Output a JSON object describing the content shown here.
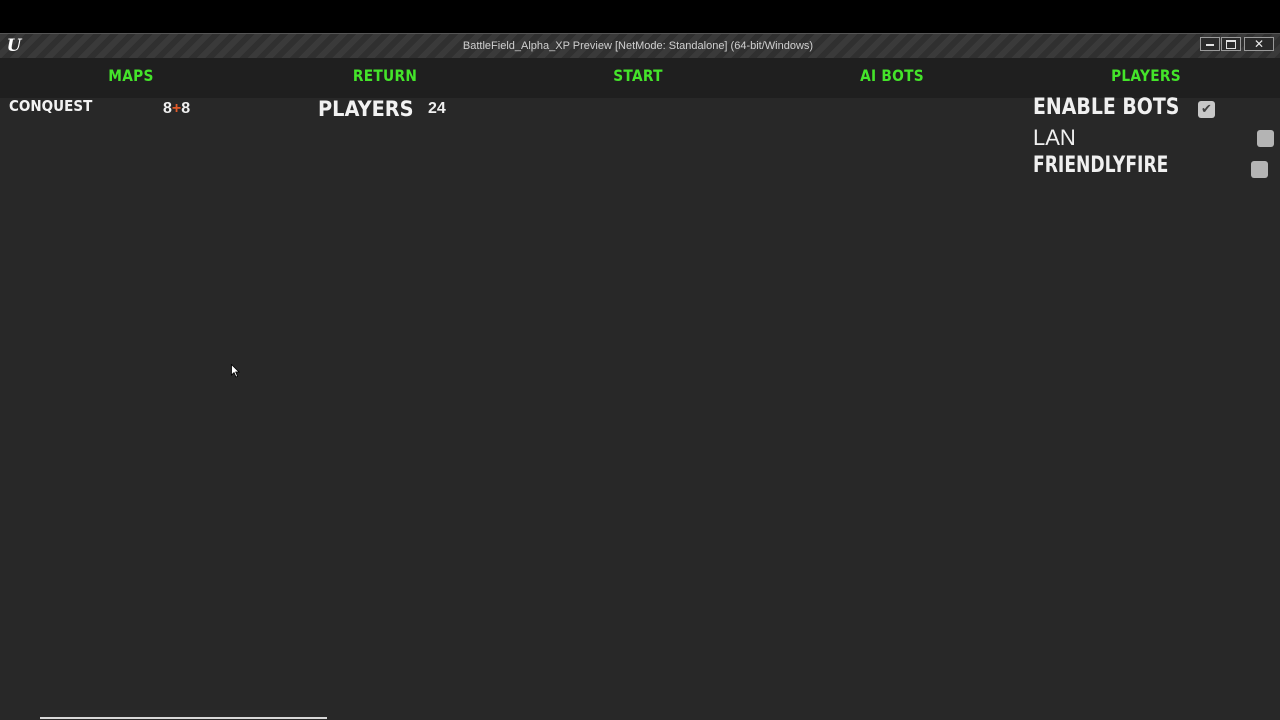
{
  "window": {
    "title": "BattleField_Alpha_XP Preview [NetMode: Standalone]  (64-bit/Windows)",
    "logo": "U",
    "controls": {
      "minimize_icon": "minimize-icon",
      "maximize_icon": "maximize-icon",
      "close_glyph": "✕"
    }
  },
  "menu": {
    "items": [
      {
        "label": "MAPS"
      },
      {
        "label": "RETURN"
      },
      {
        "label": "START"
      },
      {
        "label": "AI BOTS"
      },
      {
        "label": "PLAYERS"
      }
    ],
    "accent_color": "#44e42a"
  },
  "match": {
    "mode": "CONQUEST",
    "team_a": "8",
    "team_sep": "+",
    "team_b": "8",
    "players_label": "PLAYERS",
    "players_count": "24"
  },
  "options": [
    {
      "label": "ENABLE BOTS",
      "checked": true,
      "check_glyph": "✔"
    },
    {
      "label": "LAN",
      "checked": false
    },
    {
      "label": "FRIENDLYFIRE",
      "checked": false
    }
  ],
  "colors": {
    "background": "#282828",
    "menubar": "#1f1f1f",
    "accent_sep": "#e05a2a"
  }
}
